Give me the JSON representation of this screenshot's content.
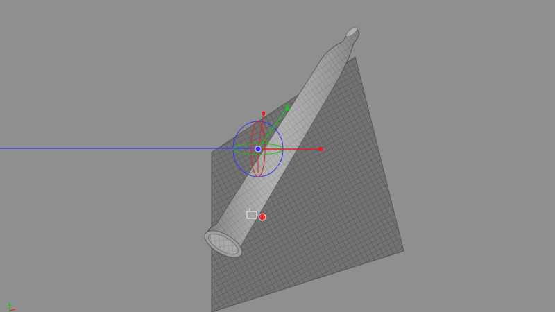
{
  "viewport": {
    "background": "#8f8f8f",
    "mesh_color": "#4d4d4d",
    "plane_color": "#777777",
    "model_color": "#a9a9a9"
  },
  "objects": [
    {
      "name": "plane-mesh",
      "type": "plane"
    },
    {
      "name": "bullet-mesh",
      "type": "capsule"
    }
  ],
  "gizmo": {
    "icon": "move-rotate-gizmo-icon",
    "axes": {
      "x": "#e02020",
      "y": "#20c020",
      "z": "#3030ff"
    }
  },
  "pivot_icon": "pivot-handle-icon",
  "world_axis_icon": "world-axis-icon"
}
